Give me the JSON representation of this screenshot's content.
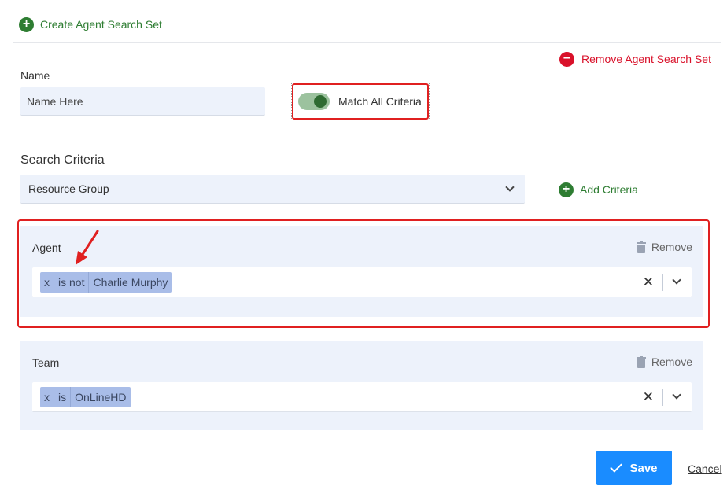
{
  "header": {
    "create_label": "Create Agent Search Set",
    "remove_set_label": "Remove Agent Search Set"
  },
  "name_field": {
    "label": "Name",
    "placeholder": "Name Here"
  },
  "toggle": {
    "label": "Match All Criteria",
    "checked": true
  },
  "search_criteria": {
    "label": "Search Criteria",
    "selected": "Resource Group",
    "add_label": "Add Criteria"
  },
  "criteria": [
    {
      "title": "Agent",
      "remove_label": "Remove",
      "chip": {
        "x": "x",
        "operator": "is not",
        "value": "Charlie Murphy"
      }
    },
    {
      "title": "Team",
      "remove_label": "Remove",
      "chip": {
        "x": "x",
        "operator": "is",
        "value": "OnLineHD"
      }
    }
  ],
  "footer": {
    "save_label": "Save",
    "cancel_label": "Cancel"
  },
  "colors": {
    "accent_green": "#2e7d32",
    "danger_red": "#d9112a",
    "primary_blue": "#1a8cff",
    "panel_bg": "#edf2fb",
    "chip_bg": "#a9bde8",
    "annotation_red": "#e02020"
  },
  "icons": [
    "plus-circle-icon",
    "minus-circle-icon",
    "chevron-down-icon",
    "trash-icon",
    "close-icon",
    "check-icon",
    "annotation-arrow-icon"
  ]
}
